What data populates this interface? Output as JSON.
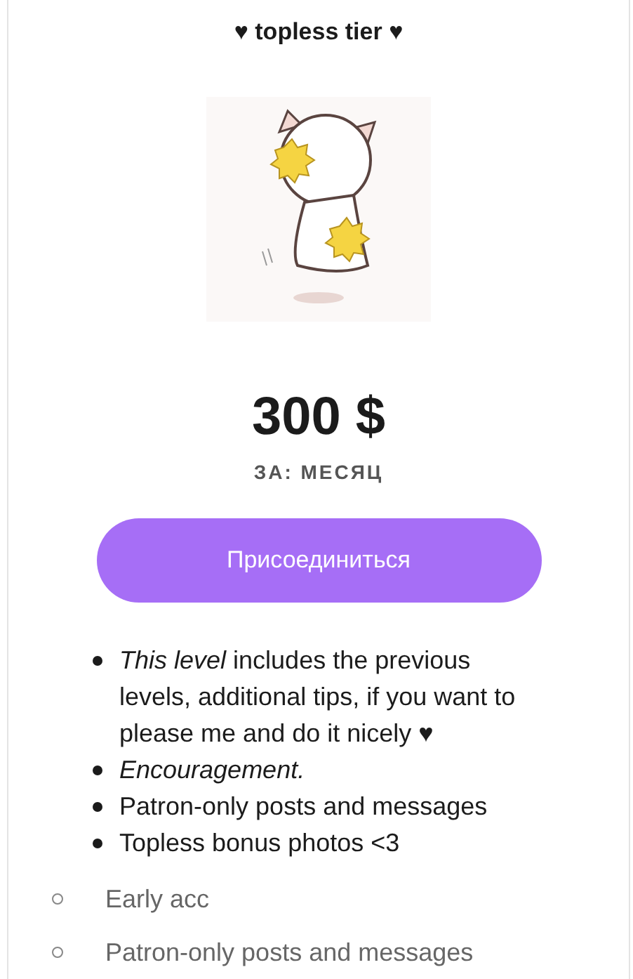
{
  "tier": {
    "title": "♥ topless tier ♥",
    "price": "300 $",
    "period": "ЗА: МЕСЯЦ",
    "join_button": "Присоединиться",
    "benefits": [
      {
        "kind": "plain",
        "text": "*This level* includes the previous levels, additional tips, if you want to please me and do it nicely ♥"
      },
      {
        "kind": "emphasis",
        "text": "Encouragement."
      },
      {
        "kind": "plain",
        "text": "Patron-only posts and messages"
      },
      {
        "kind": "plain",
        "text": "Topless bonus photos <3"
      }
    ],
    "sub_benefits": [
      "Early acc",
      "Patron-only posts and messages"
    ]
  }
}
